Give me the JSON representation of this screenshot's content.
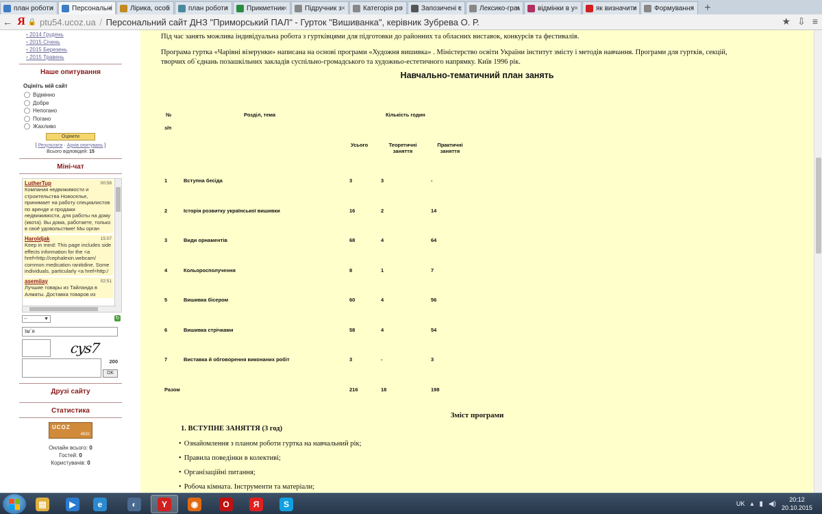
{
  "browser": {
    "tabs": [
      {
        "title": "план роботи",
        "icon_color": "#3c7dc4",
        "active": false
      },
      {
        "title": "Персональні",
        "icon_color": "#3c7dc4",
        "active": true
      },
      {
        "title": "Лірика, особ",
        "icon_color": "#c28a20",
        "active": false
      },
      {
        "title": "план роботи",
        "icon_color": "#4a8a9c",
        "active": false
      },
      {
        "title": "Прикметник",
        "icon_color": "#2a8a40",
        "active": false
      },
      {
        "title": "Підручник з",
        "icon_color": "#888888",
        "active": false
      },
      {
        "title": "Категорія ро",
        "icon_color": "#888888",
        "active": false
      },
      {
        "title": "Запозичені с",
        "icon_color": "#555555",
        "active": false
      },
      {
        "title": "Лексико-грам",
        "icon_color": "#888888",
        "active": false
      },
      {
        "title": "відмінки в у",
        "icon_color": "#b03060",
        "active": false
      },
      {
        "title": "як визначити",
        "icon_color": "#d02020",
        "active": false
      },
      {
        "title": "Формування",
        "icon_color": "#888888",
        "active": false
      }
    ],
    "new_tab": "+",
    "url_domain": "ptu54.ucoz.ua",
    "page_title": "Персональний сайт ДНЗ \"Приморський ПАЛ\" - Гурток \"Вишиванка\", керівник Зубрева О. Р."
  },
  "sidebar": {
    "archive": [
      "2014 Грудень",
      "2015 Січень",
      "2015 Березень",
      "2015 Травень"
    ],
    "poll_heading": "Наше опитування",
    "poll_question": "Оцініть мій сайт",
    "poll_options": [
      "Відмінно",
      "Добре",
      "Непогано",
      "Погано",
      "Жахливо"
    ],
    "poll_button": "Оцінити",
    "poll_results": "Результати",
    "poll_archive": "Архів опитувань",
    "poll_total_label": "Всього відповідей:",
    "poll_total_value": "15",
    "chat_heading": "Міні-чат",
    "chat_messages": [
      {
        "author": "LutherTup",
        "time": "00:58",
        "text": "Компания недвижимости и строительства Новоселье, принимает на работу специалистов по аренде и продажи недвижимости, для работы на дому (квота). Вы дома, работаете, только в своё удовольствие! Мы орган"
      },
      {
        "author": "Haroldjak",
        "time": "15:07",
        "text": "Keep in mind: This page includes side effects information for the <a href=http://cephalexin.webcam/ common medication ranitidine. Some individuals, particularly <a href=http:/"
      },
      {
        "author": "asemiiay",
        "time": "02:51",
        "text": "Лучшие товары из Тайланда в Алматы. Доставка товаров из"
      }
    ],
    "chat_select_value": "--",
    "chat_name_placeholder": "Ім`я",
    "captcha_text": "cys7",
    "char_counter": "200",
    "ok_button": "OK",
    "friends_heading": "Друзі сайту",
    "stats_heading": "Статистика",
    "stat_badge_top": "UCOZ",
    "stat_badge_count": "4632",
    "online_total_label": "Онлайн всього:",
    "online_total": "0",
    "guests_label": "Гостей:",
    "guests": "0",
    "users_label": "Користувачів:",
    "users": "0"
  },
  "main": {
    "para1": "Під час занять можлива індивідуальна робота з гуртківцями для підготовки до районних та обласних виставок, конкурсів та фестивалів.",
    "para2_line1": "Програма гуртка «Чарівні візерунки» написана на основі програми «Художня вишивка» . Міністерство освіти України інститут змісту і методів навчання. Програми для гуртків, секцій,",
    "para2_line2": "творчих об`єднань позашкільних закладів суспільно-громадського та художньо-естетичного напрямку. Київ 1996 рік.",
    "plan_title": "Навчально-тематичний план занять",
    "table": {
      "h_num": "№",
      "h_num2": "з/п",
      "h_topic": "Розділ, тема",
      "h_hours": "Кількість годин",
      "h_total": "Усього",
      "h_theory": "Теоретичні заняття",
      "h_practice": "Практичні заняття",
      "rows": [
        {
          "n": "1",
          "topic": "Вступна бесіда",
          "total": "3",
          "theory": "3",
          "practice": "-"
        },
        {
          "n": "2",
          "topic": "Історія розвитку української вишивки",
          "total": "16",
          "theory": "2",
          "practice": "14"
        },
        {
          "n": "3",
          "topic": "Види орнаментів",
          "total": "68",
          "theory": "4",
          "practice": "64"
        },
        {
          "n": "4",
          "topic": "Кольоросполучення",
          "total": "8",
          "theory": "1",
          "practice": "7"
        },
        {
          "n": "5",
          "topic": "Вишивка бісером",
          "total": "60",
          "theory": "4",
          "practice": "56"
        },
        {
          "n": "6",
          "topic": "Вишивка стрічками",
          "total": "58",
          "theory": "4",
          "practice": "54"
        },
        {
          "n": "7",
          "topic": "Виставка й обговорення виконаних робіт",
          "total": "3",
          "theory": "-",
          "practice": "3"
        }
      ],
      "sum_label": "Разом",
      "sum_total": "216",
      "sum_theory": "18",
      "sum_practice": "198"
    },
    "program_title": "Зміст програми",
    "section1": "1. ВСТУПНЕ ЗАНЯТТЯ (3 год)",
    "bullets": [
      "Ознайомлення з планом роботи гуртка на навчальний рік;",
      "Правила поведінки в колективі;",
      "Організаційні питання;",
      "Робоча кімната. Інструменти та матеріали;"
    ]
  },
  "taskbar": {
    "lang": "UK",
    "time": "20:12",
    "date": "20.10.2015",
    "apps": [
      {
        "name": "explorer",
        "color": "#e0b040",
        "glyph": "▤"
      },
      {
        "name": "media-player",
        "color": "#2a7ad0",
        "glyph": "▶"
      },
      {
        "name": "ie",
        "color": "#2a8ad0",
        "glyph": "e"
      },
      {
        "name": "volume",
        "color": "#4a6a90",
        "glyph": "◐"
      },
      {
        "name": "yandex-browser",
        "color": "#d02020",
        "glyph": "Y"
      },
      {
        "name": "firefox",
        "color": "#e06a10",
        "glyph": "◉"
      },
      {
        "name": "opera",
        "color": "#c01010",
        "glyph": "O"
      },
      {
        "name": "yandex",
        "color": "#e02020",
        "glyph": "Я"
      },
      {
        "name": "skype",
        "color": "#10a0e0",
        "glyph": "S"
      }
    ]
  }
}
